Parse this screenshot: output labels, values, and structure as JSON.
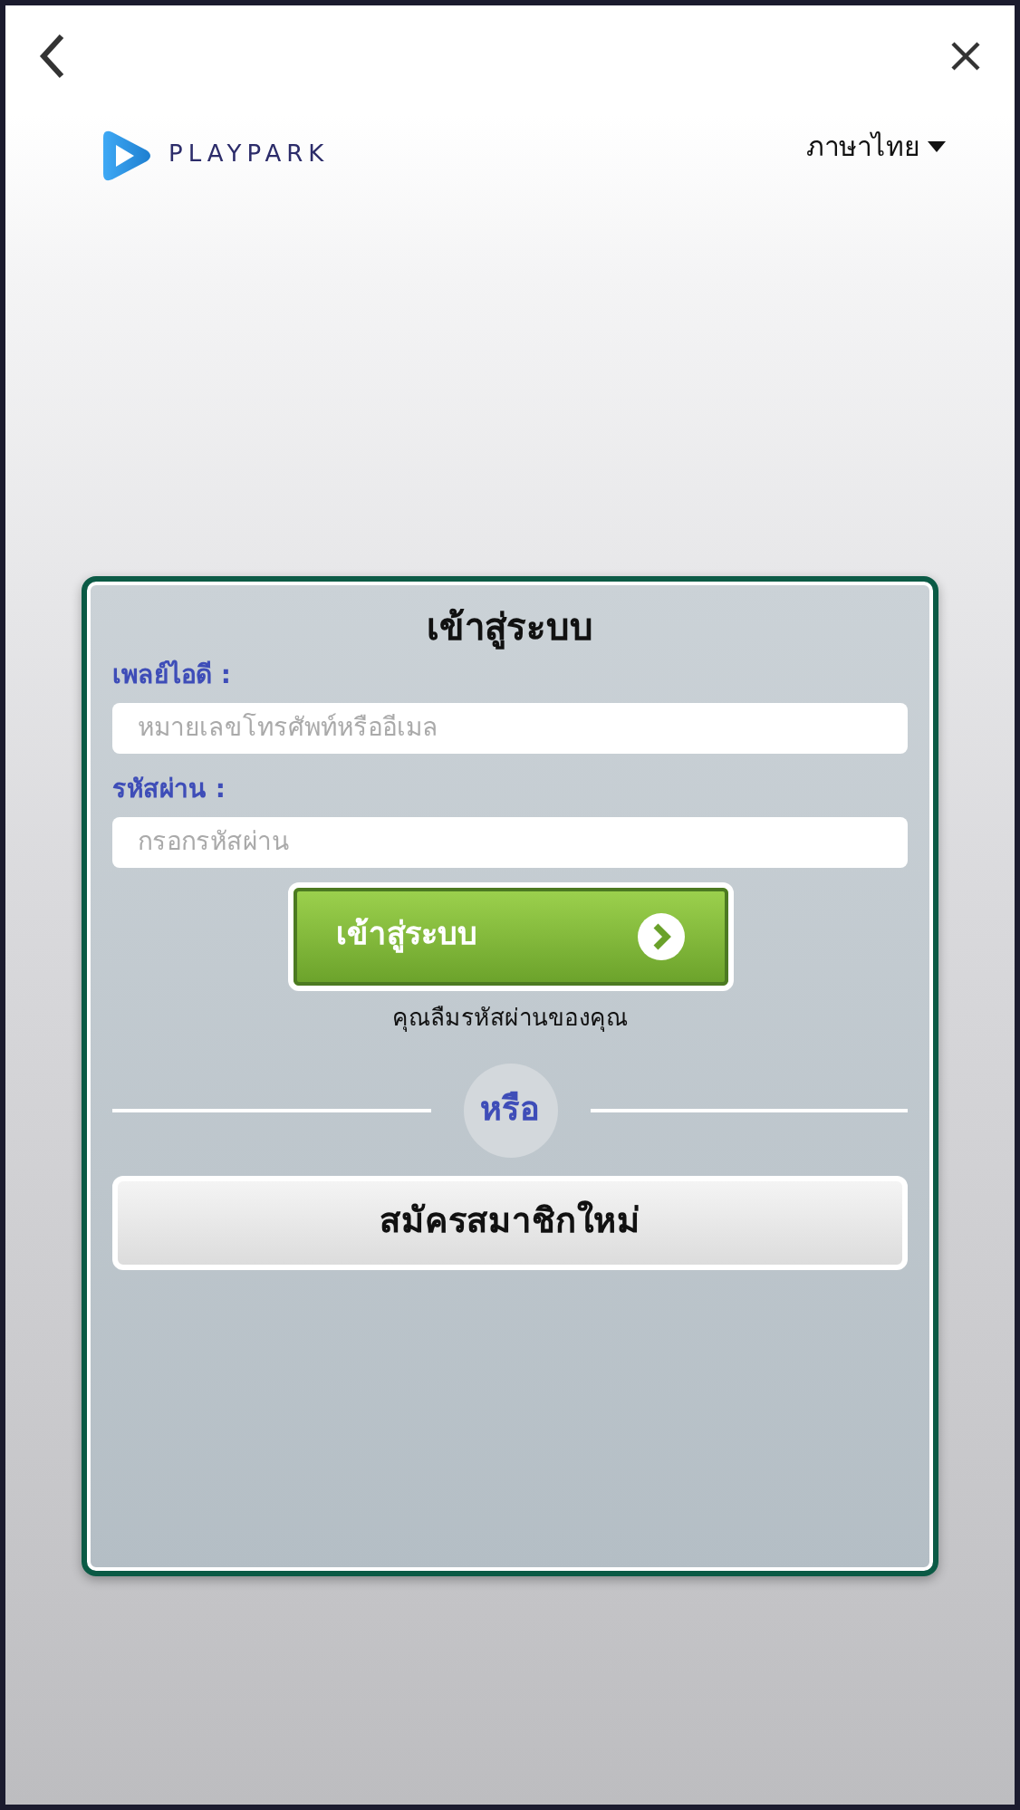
{
  "header": {
    "logo_text": "PLAYPARK",
    "language": "ภาษาไทย"
  },
  "login": {
    "title": "เข้าสู่ระบบ",
    "fields": [
      {
        "label": "เพลย์ไอดี :",
        "placeholder": "หมายเลขโทรศัพท์หรืออีเมล"
      },
      {
        "label": "รหัสผ่าน :",
        "placeholder": "กรอกรหัสผ่าน"
      }
    ],
    "submit": "เข้าสู่ระบบ",
    "forgot": "คุณลืมรหัสผ่านของคุณ",
    "divider": "หรือ",
    "register": "สมัครสมาชิกใหม่"
  }
}
